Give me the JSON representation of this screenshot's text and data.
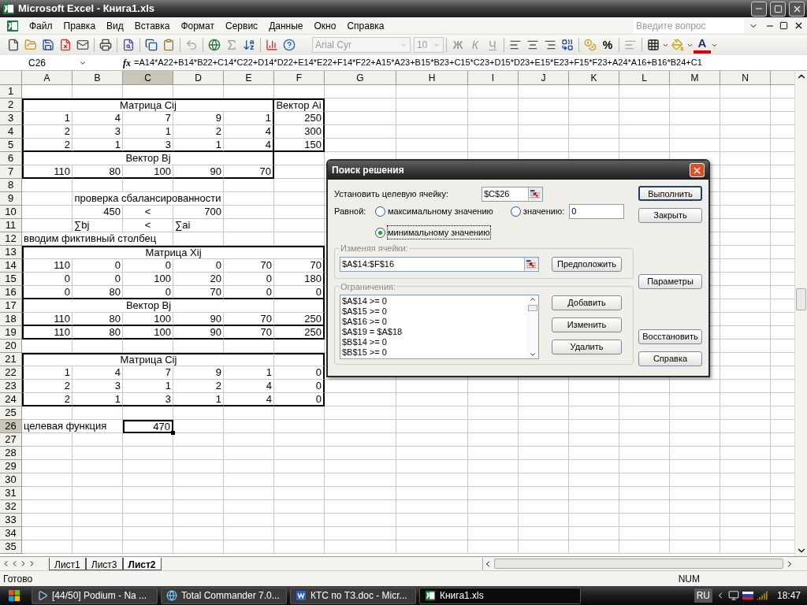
{
  "window": {
    "title": "Microsoft Excel - Книга1.xls"
  },
  "menu": [
    "Файл",
    "Правка",
    "Вид",
    "Вставка",
    "Формат",
    "Сервис",
    "Данные",
    "Окно",
    "Справка"
  ],
  "help_box": {
    "placeholder": "Введите вопрос"
  },
  "toolbar": {
    "font": "Arial Cyr",
    "size": "10",
    "styles": [
      "Ж",
      "К",
      "Ч"
    ],
    "percent": "%",
    "font_color": "A"
  },
  "formula_bar": {
    "name_box": "C26",
    "fx": "fx",
    "formula": "=A14*A22+B14*B22+C14*C22+D14*D22+E14*E22+F14*F22+A15*A23+B15*B23+C15*C23+D15*D23+E15*E23+F15*F23+A24*A16+B16*B24+C1"
  },
  "columns": [
    {
      "label": "A",
      "selected": false
    },
    {
      "label": "B",
      "selected": false
    },
    {
      "label": "C",
      "selected": true
    },
    {
      "label": "D",
      "selected": false
    },
    {
      "label": "E",
      "selected": false
    },
    {
      "label": "F",
      "selected": false
    },
    {
      "label": "G",
      "selected": false
    },
    {
      "label": "H",
      "selected": false
    },
    {
      "label": "I",
      "selected": false
    },
    {
      "label": "J",
      "selected": false
    },
    {
      "label": "K",
      "selected": false
    },
    {
      "label": "L",
      "selected": false
    },
    {
      "label": "M",
      "selected": false
    },
    {
      "label": "N",
      "selected": false
    }
  ],
  "rows": [
    {
      "n": "1",
      "selected": false
    },
    {
      "n": "2",
      "selected": false,
      "cells": [
        {
          "kind": "merge5",
          "text": "Матрица Cij",
          "centered": true,
          "thick_top": true,
          "thick_left": true,
          "thick_right": true
        },
        {
          "kind": "cell",
          "text": "Вектор Ai",
          "centered": true,
          "thick_top": true,
          "thick_right": true
        }
      ]
    },
    {
      "n": "3",
      "selected": false,
      "cells": [
        {
          "kind": "cell",
          "text": "1",
          "thick_left": true
        },
        {
          "kind": "cell",
          "text": "4"
        },
        {
          "kind": "cell",
          "text": "7"
        },
        {
          "kind": "cell",
          "text": "9"
        },
        {
          "kind": "cell",
          "text": "1",
          "thick_right": true
        },
        {
          "kind": "cell",
          "text": "250",
          "thick_right": true
        }
      ]
    },
    {
      "n": "4",
      "selected": false,
      "cells": [
        {
          "kind": "cell",
          "text": "2",
          "thick_left": true
        },
        {
          "kind": "cell",
          "text": "3"
        },
        {
          "kind": "cell",
          "text": "1"
        },
        {
          "kind": "cell",
          "text": "2"
        },
        {
          "kind": "cell",
          "text": "4",
          "thick_right": true
        },
        {
          "kind": "cell",
          "text": "300",
          "thick_right": true
        }
      ]
    },
    {
      "n": "5",
      "selected": false,
      "cells": [
        {
          "kind": "cell",
          "text": "2",
          "thick_left": true,
          "thick_bottom": true
        },
        {
          "kind": "cell",
          "text": "1",
          "thick_bottom": true
        },
        {
          "kind": "cell",
          "text": "3",
          "thick_bottom": true
        },
        {
          "kind": "cell",
          "text": "1",
          "thick_bottom": true
        },
        {
          "kind": "cell",
          "text": "4",
          "thick_right": true,
          "thick_bottom": true
        },
        {
          "kind": "cell",
          "text": "150",
          "thick_right": true,
          "thick_bottom": true
        }
      ]
    },
    {
      "n": "6",
      "selected": false,
      "cells": [
        {
          "kind": "merge5",
          "text": "Вектор Bj",
          "centered": true,
          "thick_left": true,
          "thick_right": true
        }
      ]
    },
    {
      "n": "7",
      "selected": false,
      "cells": [
        {
          "kind": "cell",
          "text": "110",
          "thick_left": true,
          "thick_bottom": true
        },
        {
          "kind": "cell",
          "text": "80",
          "thick_bottom": true
        },
        {
          "kind": "cell",
          "text": "100",
          "thick_bottom": true
        },
        {
          "kind": "cell",
          "text": "90",
          "thick_bottom": true
        },
        {
          "kind": "cell",
          "text": "70",
          "thick_right": true,
          "thick_bottom": true
        }
      ]
    },
    {
      "n": "8",
      "selected": false
    },
    {
      "n": "9",
      "selected": false,
      "cells": [
        {
          "kind": "cell"
        },
        {
          "kind": "merge3",
          "text": "проверка сбалансированности",
          "centered": true
        }
      ]
    },
    {
      "n": "10",
      "selected": false,
      "cells": [
        {
          "kind": "cell"
        },
        {
          "kind": "cell",
          "text": "450"
        },
        {
          "kind": "cell",
          "text": "<",
          "centered": true
        },
        {
          "kind": "cell",
          "text": "700"
        }
      ]
    },
    {
      "n": "11",
      "selected": false,
      "cells": [
        {
          "kind": "cell"
        },
        {
          "kind": "cell",
          "text": "∑bj",
          "left_aligned": true
        },
        {
          "kind": "cell",
          "text": "<",
          "centered": true
        },
        {
          "kind": "cell",
          "text": "∑ai",
          "left_aligned": true
        }
      ]
    },
    {
      "n": "12",
      "selected": false,
      "cells": [
        {
          "kind": "merge3",
          "text": "вводим фиктивный столбец",
          "left_aligned": true
        }
      ]
    },
    {
      "n": "13",
      "selected": false,
      "cells": [
        {
          "kind": "merge6",
          "text": "Матрица Xij",
          "centered": true,
          "thick_top": true,
          "thick_left": true,
          "thick_right": true
        }
      ]
    },
    {
      "n": "14",
      "selected": false,
      "cells": [
        {
          "kind": "cell",
          "text": "110",
          "thick_left": true
        },
        {
          "kind": "cell",
          "text": "0"
        },
        {
          "kind": "cell",
          "text": "0"
        },
        {
          "kind": "cell",
          "text": "0"
        },
        {
          "kind": "cell",
          "text": "70"
        },
        {
          "kind": "cell",
          "text": "70",
          "thick_right": true
        }
      ]
    },
    {
      "n": "15",
      "selected": false,
      "cells": [
        {
          "kind": "cell",
          "text": "0",
          "thick_left": true
        },
        {
          "kind": "cell",
          "text": "0"
        },
        {
          "kind": "cell",
          "text": "100"
        },
        {
          "kind": "cell",
          "text": "20"
        },
        {
          "kind": "cell",
          "text": "0"
        },
        {
          "kind": "cell",
          "text": "180",
          "thick_right": true
        }
      ]
    },
    {
      "n": "16",
      "selected": false,
      "cells": [
        {
          "kind": "cell",
          "text": "0",
          "thick_left": true,
          "thick_bottom": true
        },
        {
          "kind": "cell",
          "text": "80",
          "thick_bottom": true
        },
        {
          "kind": "cell",
          "text": "0",
          "thick_bottom": true
        },
        {
          "kind": "cell",
          "text": "70",
          "thick_bottom": true
        },
        {
          "kind": "cell",
          "text": "0",
          "thick_bottom": true
        },
        {
          "kind": "cell",
          "text": "0",
          "thick_right": true,
          "thick_bottom": true
        }
      ]
    },
    {
      "n": "17",
      "selected": false,
      "cells": [
        {
          "kind": "merge5",
          "text": "Вектор Bj",
          "centered": true,
          "thick_left": true
        },
        {
          "kind": "cell",
          "thick_right": true
        }
      ]
    },
    {
      "n": "18",
      "selected": false,
      "cells": [
        {
          "kind": "cell",
          "text": "110",
          "thick_left": true,
          "thick_bottom": true
        },
        {
          "kind": "cell",
          "text": "80",
          "thick_bottom": true
        },
        {
          "kind": "cell",
          "text": "100",
          "thick_bottom": true
        },
        {
          "kind": "cell",
          "text": "90",
          "thick_bottom": true
        },
        {
          "kind": "cell",
          "text": "70",
          "thick_bottom": true
        },
        {
          "kind": "cell",
          "text": "250",
          "thick_right": true,
          "thick_bottom": true
        }
      ]
    },
    {
      "n": "19",
      "selected": false,
      "cells": [
        {
          "kind": "cell",
          "text": "110",
          "thick_left": true,
          "thick_bottom": true
        },
        {
          "kind": "cell",
          "text": "80",
          "thick_bottom": true
        },
        {
          "kind": "cell",
          "text": "100",
          "thick_bottom": true
        },
        {
          "kind": "cell",
          "text": "90",
          "thick_bottom": true
        },
        {
          "kind": "cell",
          "text": "70",
          "thick_bottom": true
        },
        {
          "kind": "cell",
          "text": "250",
          "thick_right": true,
          "thick_bottom": true
        }
      ]
    },
    {
      "n": "20",
      "selected": false
    },
    {
      "n": "21",
      "selected": false,
      "cells": [
        {
          "kind": "merge5",
          "text": "Матрица Cij",
          "centered": true,
          "thick_top": true,
          "thick_left": true
        },
        {
          "kind": "cell",
          "thick_top": true,
          "thick_right": true
        }
      ]
    },
    {
      "n": "22",
      "selected": false,
      "cells": [
        {
          "kind": "cell",
          "text": "1",
          "thick_left": true
        },
        {
          "kind": "cell",
          "text": "4"
        },
        {
          "kind": "cell",
          "text": "7"
        },
        {
          "kind": "cell",
          "text": "9"
        },
        {
          "kind": "cell",
          "text": "1"
        },
        {
          "kind": "cell",
          "text": "0",
          "thick_right": true
        }
      ]
    },
    {
      "n": "23",
      "selected": false,
      "cells": [
        {
          "kind": "cell",
          "text": "2",
          "thick_left": true
        },
        {
          "kind": "cell",
          "text": "3"
        },
        {
          "kind": "cell",
          "text": "1"
        },
        {
          "kind": "cell",
          "text": "2"
        },
        {
          "kind": "cell",
          "text": "4"
        },
        {
          "kind": "cell",
          "text": "0",
          "thick_right": true
        }
      ]
    },
    {
      "n": "24",
      "selected": false,
      "cells": [
        {
          "kind": "cell",
          "text": "2",
          "thick_left": true,
          "thick_bottom": true
        },
        {
          "kind": "cell",
          "text": "1",
          "thick_bottom": true
        },
        {
          "kind": "cell",
          "text": "3",
          "thick_bottom": true
        },
        {
          "kind": "cell",
          "text": "1",
          "thick_bottom": true
        },
        {
          "kind": "cell",
          "text": "4",
          "thick_bottom": true
        },
        {
          "kind": "cell",
          "text": "0",
          "thick_right": true,
          "thick_bottom": true
        }
      ]
    },
    {
      "n": "25",
      "selected": false
    },
    {
      "n": "26",
      "selected": true,
      "cells": [
        {
          "kind": "merge2",
          "text": "целевая функция",
          "left_aligned": true
        },
        {
          "kind": "cell",
          "text": "470"
        }
      ]
    },
    {
      "n": "27",
      "selected": false
    },
    {
      "n": "28",
      "selected": false
    },
    {
      "n": "29",
      "selected": false
    },
    {
      "n": "30",
      "selected": false
    },
    {
      "n": "31",
      "selected": false
    },
    {
      "n": "32",
      "selected": false
    },
    {
      "n": "33",
      "selected": false
    },
    {
      "n": "34",
      "selected": false
    },
    {
      "n": "35",
      "selected": false
    }
  ],
  "dialog": {
    "title": "Поиск решения",
    "target_label": "Установить целевую ячейку:",
    "target": "$C$26",
    "equal_label": "Равной:",
    "options": [
      {
        "label": "максимальному значению",
        "selected": false
      },
      {
        "label": "значению:",
        "selected": false
      },
      {
        "label": "минимальному значению",
        "selected": true
      }
    ],
    "value": "0",
    "changing_label": "Изменяя ячейки:",
    "changing": "$A$14:$F$16",
    "guess": "Предположить",
    "constraints_label": "Ограничения:",
    "constraints": [
      "$A$14 >= 0",
      "$A$15 >= 0",
      "$A$16 >= 0",
      "$A$19 = $A$18",
      "$B$14 >= 0",
      "$B$15 >= 0"
    ],
    "list_buttons": [
      "Добавить",
      "Изменить",
      "Удалить"
    ],
    "side_buttons": [
      "Выполнить",
      "Закрыть",
      "Параметры",
      "Восстановить",
      "Справка"
    ]
  },
  "sheet_tabs": [
    {
      "label": "Лист1",
      "selected": false
    },
    {
      "label": "Лист3",
      "selected": false
    },
    {
      "label": "Лист2",
      "selected": true
    }
  ],
  "status_bar": {
    "left": "Готово",
    "right": "NUM"
  },
  "taskbar": {
    "tasks": [
      {
        "kind": "player",
        "label": "[44/50] Podium - Na ...",
        "selected": false
      },
      {
        "kind": "commander",
        "label": "Total Commander 7.0...",
        "selected": false
      },
      {
        "kind": "word",
        "label": "КТС по ТЗ.doc - Micr...",
        "selected": false
      },
      {
        "kind": "excel",
        "label": "Книга1.xls",
        "selected": true
      }
    ],
    "language": "RU",
    "clock": "18:47"
  }
}
